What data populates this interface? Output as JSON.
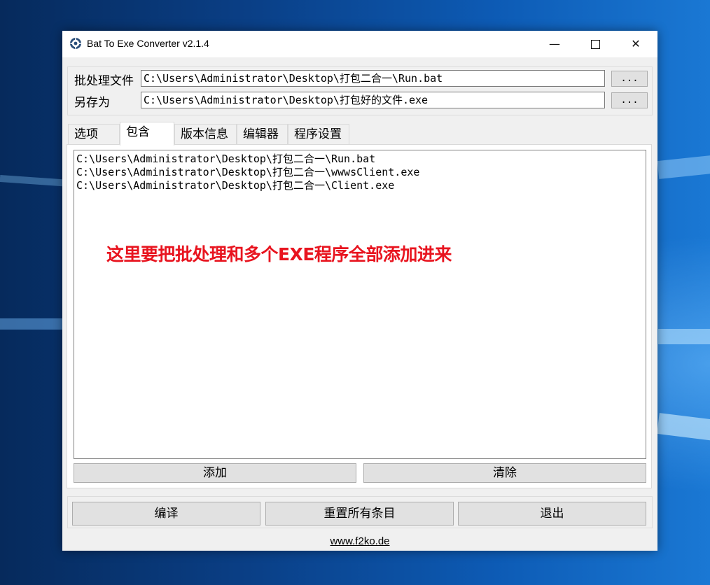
{
  "window": {
    "title": "Bat To Exe Converter v2.1.4",
    "controls": {
      "minimize": "—",
      "close": "✕"
    }
  },
  "files": {
    "batch_label": "批处理文件",
    "batch_value": "C:\\Users\\Administrator\\Desktop\\打包二合一\\Run.bat",
    "saveas_label": "另存为",
    "saveas_value": "C:\\Users\\Administrator\\Desktop\\打包好的文件.exe",
    "browse_label": "..."
  },
  "tabs": [
    {
      "label": "选项",
      "active": false
    },
    {
      "label": "包含",
      "active": true
    },
    {
      "label": "版本信息",
      "active": false
    },
    {
      "label": "编辑器",
      "active": false
    },
    {
      "label": "程序设置",
      "active": false
    }
  ],
  "include": {
    "items": [
      "C:\\Users\\Administrator\\Desktop\\打包二合一\\Run.bat",
      "C:\\Users\\Administrator\\Desktop\\打包二合一\\wwwsClient.exe",
      "C:\\Users\\Administrator\\Desktop\\打包二合一\\Client.exe"
    ],
    "annotation": "这里要把批处理和多个EXE程序全部添加进来",
    "annotation_color": "#e8141f",
    "add_label": "添加",
    "clear_label": "清除"
  },
  "actions": {
    "compile_label": "编译",
    "reset_label": "重置所有条目",
    "exit_label": "退出"
  },
  "footer": {
    "link": "www.f2ko.de"
  }
}
